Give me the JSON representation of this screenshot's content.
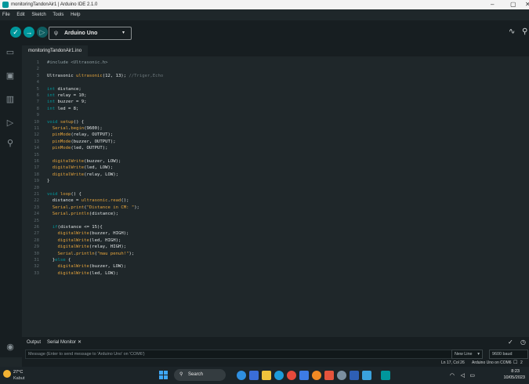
{
  "window": {
    "title": "monitoringTandonAir1 | Arduino IDE 2.1.0",
    "minimize": "–",
    "maximize": "▢",
    "close": "✕"
  },
  "menu": [
    "File",
    "Edit",
    "Sketch",
    "Tools",
    "Help"
  ],
  "toolbar": {
    "verify_icon": "check-icon",
    "upload_icon": "arrow-right-icon",
    "debug_icon": "debug-icon",
    "board": "Arduino Uno",
    "board_caret": "▾",
    "serial_plotter_icon": "waveform-icon",
    "serial_monitor_icon": "magnifier-icon"
  },
  "tabs": {
    "active_file": "monitoringTandonAir1.ino"
  },
  "editor": {
    "lines": [
      {
        "n": "1",
        "parts": [
          [
            "inc",
            "#include <Ultrasonic.h>"
          ]
        ]
      },
      {
        "n": "2",
        "parts": []
      },
      {
        "n": "3",
        "parts": [
          [
            "",
            "Ultrasonic "
          ],
          [
            "fn",
            "ultrasonic"
          ],
          [
            "",
            "(12, 13); "
          ],
          [
            "cm",
            "//Triger,Echo"
          ]
        ]
      },
      {
        "n": "4",
        "parts": []
      },
      {
        "n": "5",
        "parts": [
          [
            "kw",
            "int"
          ],
          [
            "",
            " distance;"
          ]
        ]
      },
      {
        "n": "6",
        "parts": [
          [
            "kw",
            "int"
          ],
          [
            "",
            " relay = 10;"
          ]
        ]
      },
      {
        "n": "7",
        "parts": [
          [
            "kw",
            "int"
          ],
          [
            "",
            " buzzer = 9;"
          ]
        ]
      },
      {
        "n": "8",
        "parts": [
          [
            "kw",
            "int"
          ],
          [
            "",
            " led = 8;"
          ]
        ]
      },
      {
        "n": "9",
        "parts": []
      },
      {
        "n": "10",
        "parts": [
          [
            "kw",
            "void"
          ],
          [
            "",
            " "
          ],
          [
            "fn",
            "setup"
          ],
          [
            "",
            "() {"
          ]
        ]
      },
      {
        "n": "11",
        "parts": [
          [
            "",
            "  "
          ],
          [
            "fn",
            "Serial"
          ],
          [
            "",
            "."
          ],
          [
            "fn",
            "begin"
          ],
          [
            "",
            "(9600);"
          ]
        ]
      },
      {
        "n": "12",
        "parts": [
          [
            "",
            "  "
          ],
          [
            "fn",
            "pinMode"
          ],
          [
            "",
            "(relay, OUTPUT);"
          ]
        ]
      },
      {
        "n": "13",
        "parts": [
          [
            "",
            "  "
          ],
          [
            "fn",
            "pinMode"
          ],
          [
            "",
            "(buzzer, OUTPUT);"
          ]
        ]
      },
      {
        "n": "14",
        "parts": [
          [
            "",
            "  "
          ],
          [
            "fn",
            "pinMode"
          ],
          [
            "",
            "(led, OUTPUT);"
          ]
        ]
      },
      {
        "n": "15",
        "parts": []
      },
      {
        "n": "16",
        "parts": [
          [
            "",
            "  "
          ],
          [
            "fn",
            "digitalWrite"
          ],
          [
            "",
            "(buzzer, LOW);"
          ]
        ]
      },
      {
        "n": "17",
        "parts": [
          [
            "",
            "  "
          ],
          [
            "fn",
            "digitalWrite"
          ],
          [
            "",
            "(led, LOW);"
          ]
        ]
      },
      {
        "n": "18",
        "parts": [
          [
            "",
            "  "
          ],
          [
            "fn",
            "digitalWrite"
          ],
          [
            "",
            "(relay, LOW);"
          ]
        ]
      },
      {
        "n": "19",
        "parts": [
          [
            "",
            "}"
          ]
        ]
      },
      {
        "n": "20",
        "parts": []
      },
      {
        "n": "21",
        "parts": [
          [
            "kw",
            "void"
          ],
          [
            "",
            " "
          ],
          [
            "fn",
            "loop"
          ],
          [
            "",
            "() {"
          ]
        ]
      },
      {
        "n": "22",
        "parts": [
          [
            "",
            "  distance = "
          ],
          [
            "fn",
            "ultrasonic"
          ],
          [
            "",
            "."
          ],
          [
            "fn",
            "read"
          ],
          [
            "",
            "();"
          ]
        ]
      },
      {
        "n": "23",
        "parts": [
          [
            "",
            "  "
          ],
          [
            "fn",
            "Serial"
          ],
          [
            "",
            "."
          ],
          [
            "fn",
            "print"
          ],
          [
            "",
            "("
          ],
          [
            "str",
            "\"Distance in CM: \""
          ],
          [
            "",
            ");"
          ]
        ]
      },
      {
        "n": "24",
        "parts": [
          [
            "",
            "  "
          ],
          [
            "fn",
            "Serial"
          ],
          [
            "",
            "."
          ],
          [
            "fn",
            "println"
          ],
          [
            "",
            "(distance);"
          ]
        ]
      },
      {
        "n": "25",
        "parts": []
      },
      {
        "n": "26",
        "parts": [
          [
            "",
            "  "
          ],
          [
            "kw",
            "if"
          ],
          [
            "",
            "(distance <= 15){"
          ]
        ]
      },
      {
        "n": "27",
        "parts": [
          [
            "",
            "    "
          ],
          [
            "fn",
            "digitalWrite"
          ],
          [
            "",
            "(buzzer, HIGH);"
          ]
        ]
      },
      {
        "n": "28",
        "parts": [
          [
            "",
            "    "
          ],
          [
            "fn",
            "digitalWrite"
          ],
          [
            "",
            "(led, HIGH);"
          ]
        ]
      },
      {
        "n": "29",
        "parts": [
          [
            "",
            "    "
          ],
          [
            "fn",
            "digitalWrite"
          ],
          [
            "",
            "(relay, HIGH);"
          ]
        ]
      },
      {
        "n": "30",
        "parts": [
          [
            "",
            "    "
          ],
          [
            "fn",
            "Serial"
          ],
          [
            "",
            "."
          ],
          [
            "fn",
            "println"
          ],
          [
            "",
            "("
          ],
          [
            "str",
            "\"mau penuh!\""
          ],
          [
            "",
            ");"
          ]
        ]
      },
      {
        "n": "31",
        "parts": [
          [
            "",
            "  }"
          ],
          [
            "kw",
            "else"
          ],
          [
            "",
            " {"
          ]
        ]
      },
      {
        "n": "32",
        "parts": [
          [
            "",
            "    "
          ],
          [
            "fn",
            "digitalWrite"
          ],
          [
            "",
            "(buzzer, LOW);"
          ]
        ]
      },
      {
        "n": "33",
        "parts": [
          [
            "",
            "    "
          ],
          [
            "fn",
            "digitalWrite"
          ],
          [
            "",
            "(led, LOW);"
          ]
        ]
      }
    ]
  },
  "panel": {
    "output_tab": "Output",
    "serial_tab": "Serial Monitor",
    "close": "✕",
    "message_placeholder": "Message (Enter to send message to 'Arduino Uno' on 'COM6')",
    "line_ending": "New Line",
    "baud": "9600 baud"
  },
  "status": {
    "position": "Ln 17, Col 26",
    "board_port": "Arduino Uno on COM6",
    "notifications": "2"
  },
  "taskbar": {
    "temperature": "27°C",
    "location": "Kabut",
    "search": "Search",
    "time": "8:23",
    "date": "10/05/2023"
  },
  "colors": {
    "teal": "#00979c",
    "orange": "#e5a43c"
  }
}
